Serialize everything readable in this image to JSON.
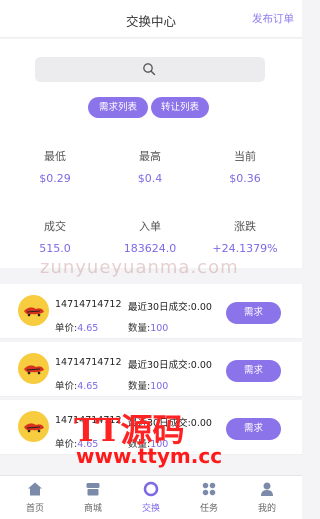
{
  "header": {
    "title": "交换中心",
    "right_link": "发布订单"
  },
  "search": {
    "icon": "search-icon"
  },
  "filters": {
    "demand": "需求列表",
    "transfer": "转让列表"
  },
  "stats": [
    {
      "label": "最低",
      "value": "$0.29"
    },
    {
      "label": "最高",
      "value": "$0.4"
    },
    {
      "label": "当前",
      "value": "$0.36"
    },
    {
      "label": "成交",
      "value": "515.0"
    },
    {
      "label": "入单",
      "value": "183624.0"
    },
    {
      "label": "涨跌",
      "value": "+24.1379%"
    }
  ],
  "orders": [
    {
      "user": "14714714712",
      "recent": "最近30日成交:0.00",
      "price_label": "单价:",
      "price": "4.65",
      "qty_label": "数量:",
      "qty": "100",
      "action": "需求"
    },
    {
      "user": "14714714712",
      "recent": "最近30日成交:0.00",
      "price_label": "单价:",
      "price": "4.65",
      "qty_label": "数量:",
      "qty": "100",
      "action": "需求"
    },
    {
      "user": "14714714712",
      "recent": "最近30日成交:0.00",
      "price_label": "单价:",
      "price": "4.65",
      "qty_label": "数量:",
      "qty": "100",
      "action": "需求"
    }
  ],
  "watermarks": {
    "domain_text": "zunyueyuanma.com",
    "brand": "TT源码",
    "url": "www.ttym.cc"
  },
  "tabs": [
    {
      "label": "首页",
      "icon": "home-icon"
    },
    {
      "label": "商城",
      "icon": "store-icon"
    },
    {
      "label": "交换",
      "icon": "exchange-icon"
    },
    {
      "label": "任务",
      "icon": "grid-icon"
    },
    {
      "label": "我的",
      "icon": "user-icon"
    }
  ],
  "colors": {
    "accent": "#8b74ea",
    "value": "#7e68e6",
    "avatar": "#f7cc3e"
  }
}
